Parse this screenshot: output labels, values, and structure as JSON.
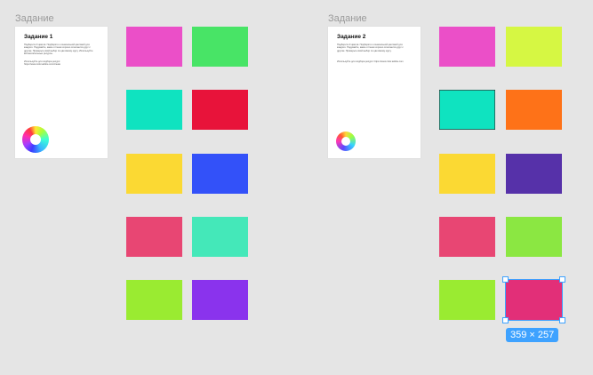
{
  "frames": [
    {
      "label": "Задание",
      "card": {
        "title": "Задание 1",
        "text": "Подберите 9 цветов. Подберите к изначальной цветовой для каждого. Подумайте, какие оттенки хорошо сочетаются друг с другом. Проверьте свой выбор по цветовому кругу. Используйте вспомогательные ресурсы.",
        "link": "Используйте для подбора ресурс: https://www.color.adobe.com/create"
      },
      "swatches": [
        "#eb4fc8",
        "#48e466",
        "#0fe3c0",
        "#e8133a",
        "#fbd933",
        "#3351f9",
        "#e84673",
        "#44e8b9",
        "#9aeb31",
        "#8a33ed"
      ]
    },
    {
      "label": "Задание",
      "card": {
        "title": "Задание 2",
        "text": "Подберите 9 цветов. Подберите к изначальной цветовой для каждого. Подумайте, какие оттенки хорошо сочетаются друг с другом. Проверьте свой выбор по цветовому кругу.",
        "link": "Используйте для подбора ресурс: https://www.color.adobe.com"
      },
      "swatches": [
        "#eb4fc8",
        "#d6f743",
        "#0fe3c0",
        "#fe7218",
        "#fbd933",
        "#5631a9",
        "#e84673",
        "#8be742",
        "#9aeb31",
        "#e22f78"
      ]
    }
  ],
  "selection": {
    "size_label": "359 × 257",
    "color": "#3ea2ff"
  },
  "icons": {
    "color_wheel": "color-wheel-icon"
  }
}
